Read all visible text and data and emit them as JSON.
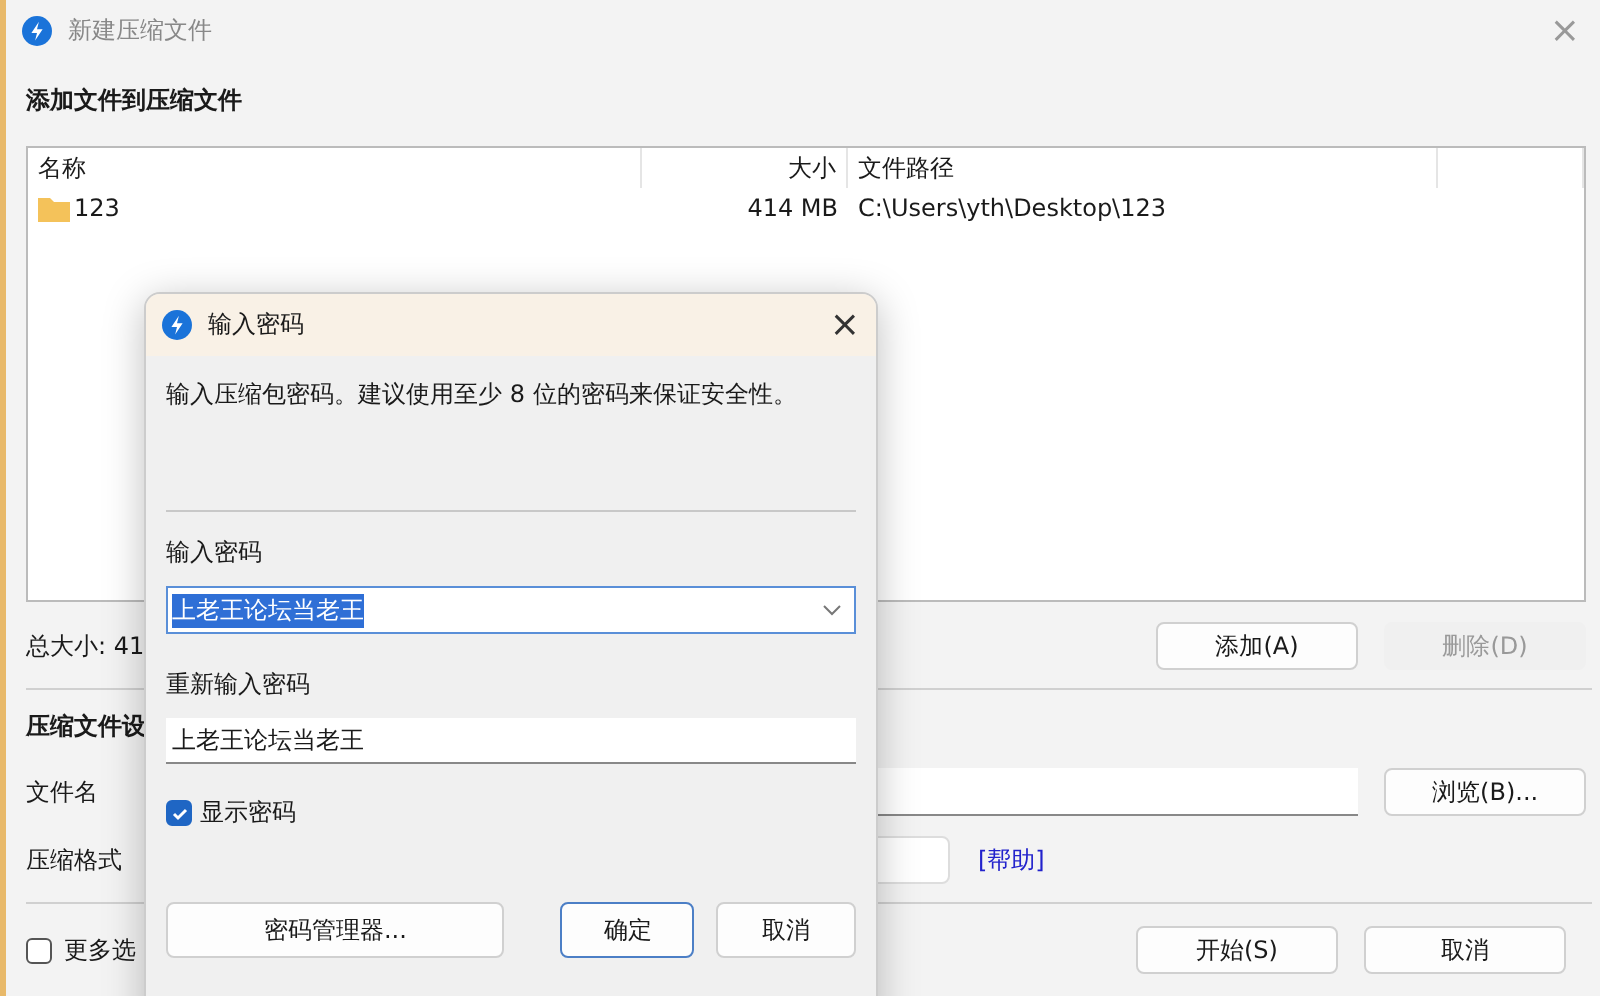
{
  "window": {
    "title": "新建压缩文件",
    "close": "×"
  },
  "add_section": {
    "heading": "添加文件到压缩文件"
  },
  "file_list": {
    "columns": [
      "名称",
      "大小",
      "文件路径"
    ],
    "rows": [
      {
        "name": "123",
        "size": "414 MB",
        "path": "C:\\Users\\yth\\Desktop\\123"
      }
    ]
  },
  "total_size": "总大小: 41",
  "list_buttons": [
    {
      "label": "添加(A)",
      "disabled": false
    },
    {
      "label": "删除(D)",
      "disabled": true
    }
  ],
  "settings": {
    "heading": "压缩文件设",
    "filename_label": "文件名",
    "browse": "浏览(B)...",
    "format_label": "压缩格式",
    "help_link": "[帮助]"
  },
  "more_options": {
    "label": "更多选",
    "checked": false
  },
  "footer_buttons": [
    "开始(S)",
    "取消"
  ],
  "dialog": {
    "title": "输入密码",
    "close": "×",
    "description": "输入压缩包密码。建议使用至少 8 位的密码来保证安全性。",
    "password_label": "输入密码",
    "password_value": "上老王论坛当老王",
    "confirm_label": "重新输入密码",
    "confirm_value": "上老王论坛当老王",
    "show_password": {
      "label": "显示密码",
      "checked": true
    },
    "buttons": [
      {
        "label": "密码管理器...",
        "default": false
      },
      {
        "label": "确定",
        "default": true
      },
      {
        "label": "取消",
        "default": false
      }
    ]
  }
}
